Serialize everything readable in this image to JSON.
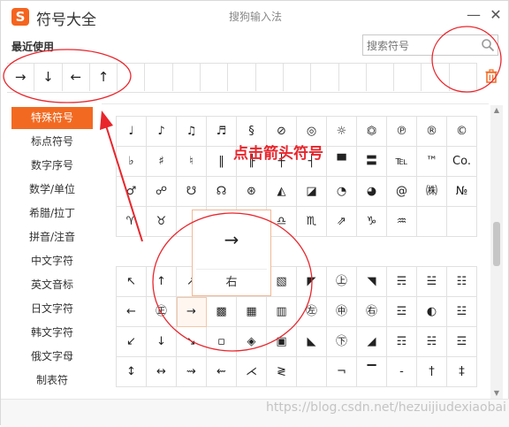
{
  "window": {
    "logo_letter": "S",
    "app_title": "符号大全",
    "center_title": "搜狗输入法",
    "minimize_glyph": "—",
    "close_glyph": "✕"
  },
  "recent": {
    "label": "最近使用",
    "items": [
      "→",
      "↓",
      "←",
      "↑",
      "",
      "",
      "",
      "",
      "",
      "",
      "",
      "",
      "",
      "",
      "",
      "",
      ""
    ]
  },
  "search": {
    "placeholder": "搜索符号"
  },
  "sidebar": {
    "items": [
      {
        "label": "特殊符号",
        "active": true
      },
      {
        "label": "标点符号"
      },
      {
        "label": "数字序号"
      },
      {
        "label": "数学/单位"
      },
      {
        "label": "希腊/拉丁"
      },
      {
        "label": "拼音/注音"
      },
      {
        "label": "中文字符"
      },
      {
        "label": "英文音标"
      },
      {
        "label": "日文字符"
      },
      {
        "label": "韩文字符"
      },
      {
        "label": "俄文字母"
      },
      {
        "label": "制表符"
      }
    ]
  },
  "grid_top": [
    [
      "♩",
      "♪",
      "♫",
      "♬",
      "§",
      "⊘",
      "◎",
      "☼",
      "⏣",
      "℗",
      "®",
      "©"
    ],
    [
      "♭",
      "♯",
      "♮",
      "‖",
      "╟",
      "┼",
      "┤",
      "▀",
      "〓",
      "℡",
      "™",
      "Co."
    ],
    [
      "♂",
      "☍",
      "☋",
      "☊",
      "⊛",
      "◭",
      "◪",
      "◔",
      "◕",
      "@",
      "㈱",
      "№"
    ],
    [
      "♈",
      "♉",
      "",
      "",
      "",
      "♎",
      "♏",
      "⇗",
      "♑",
      "♒",
      "",
      ""
    ]
  ],
  "grid_bottom": [
    [
      "↖",
      "↑",
      "↗",
      "",
      "",
      "▧",
      "◤",
      "㊤",
      "◥",
      "☴",
      "☱",
      "☷"
    ],
    [
      "←",
      "㊣",
      "→",
      "▩",
      "▦",
      "▥",
      "㊧",
      "㊥",
      "㊨",
      "☲",
      "◐",
      "☳"
    ],
    [
      "↙",
      "↓",
      "↘",
      "▫",
      "◈",
      "▣",
      "◣",
      "㊦",
      "◢",
      "☶",
      "☵",
      "☲"
    ],
    [
      "↕",
      "↔",
      "⇝",
      "⇜",
      "⋌",
      "≷",
      "",
      "¬",
      "▔",
      "‐",
      "†",
      "‡"
    ]
  ],
  "preview": {
    "symbol": "→",
    "name": "右"
  },
  "annotation": {
    "text": "点击箭头符号"
  },
  "watermark": "https://blog.csdn.net/hezuijiudexiaobai",
  "colors": {
    "accent": "#f26a21",
    "annotation": "#e8262c"
  }
}
